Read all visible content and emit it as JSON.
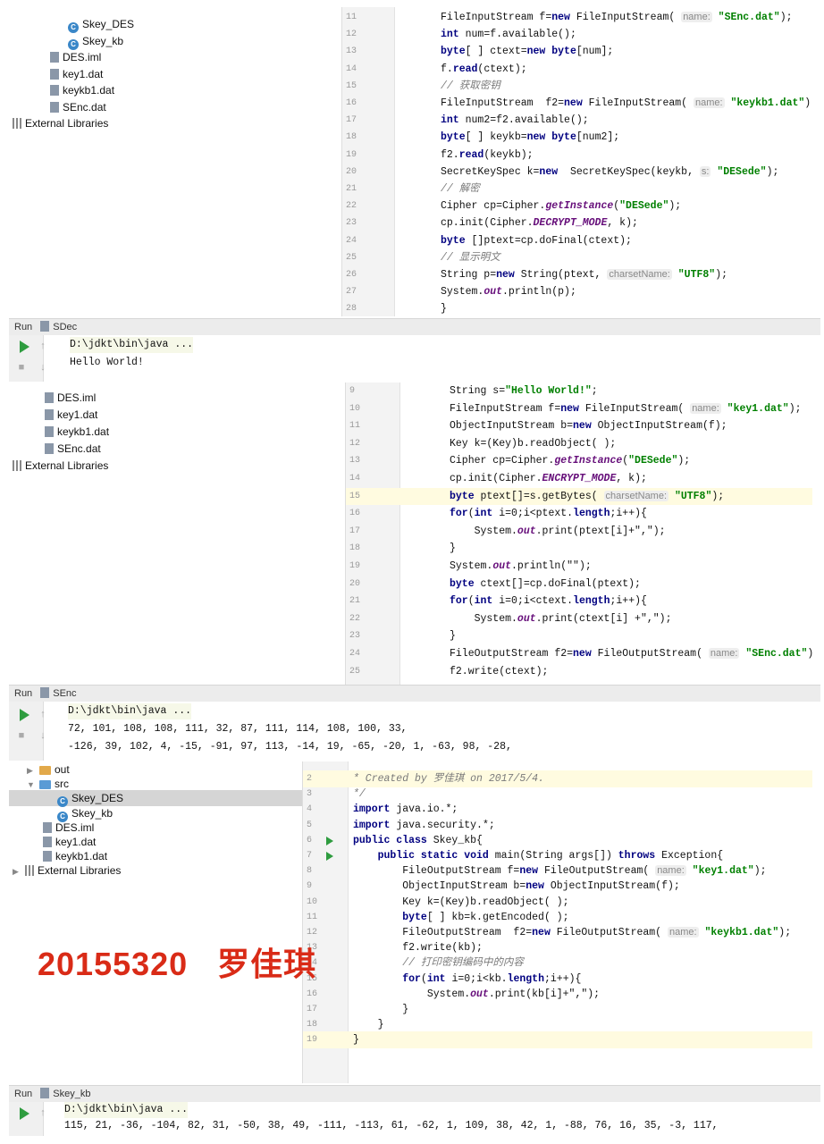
{
  "p1": {
    "tree": [
      {
        "label": "Skey_DES",
        "icon": "class-icon"
      },
      {
        "label": "Skey_kb",
        "icon": "class-icon"
      },
      {
        "label": "DES.iml",
        "icon": "file-icon"
      },
      {
        "label": "key1.dat",
        "icon": "file-icon"
      },
      {
        "label": "keykb1.dat",
        "icon": "file-icon"
      },
      {
        "label": "SEnc.dat",
        "icon": "file-icon"
      },
      {
        "label": "External Libraries",
        "icon": "library-icon"
      }
    ],
    "lines": [
      {
        "n": "11",
        "segs": [
          [
            "",
            "FileInputStream f="
          ],
          [
            "kw",
            "new"
          ],
          [
            "",
            " FileInputStream( "
          ],
          [
            "hint",
            "name:"
          ],
          [
            "",
            " "
          ],
          [
            "str",
            "\"SEnc.dat\""
          ],
          [
            "",
            ");"
          ]
        ]
      },
      {
        "n": "12",
        "segs": [
          [
            "kw",
            "int"
          ],
          [
            "",
            " num=f.available();"
          ]
        ]
      },
      {
        "n": "13",
        "segs": [
          [
            "kw",
            "byte"
          ],
          [
            "",
            "[ ] ctext="
          ],
          [
            "kw",
            "new"
          ],
          [
            "",
            " "
          ],
          [
            "kw",
            "byte"
          ],
          [
            "",
            "[num];"
          ]
        ]
      },
      {
        "n": "14",
        "segs": [
          [
            "",
            "f."
          ],
          [
            "kw",
            "read"
          ],
          [
            "",
            "(ctext);"
          ]
        ]
      },
      {
        "n": "15",
        "segs": [
          [
            "cm",
            "// 获取密钥"
          ]
        ]
      },
      {
        "n": "16",
        "segs": [
          [
            "",
            "FileInputStream  f2="
          ],
          [
            "kw",
            "new"
          ],
          [
            "",
            " FileInputStream( "
          ],
          [
            "hint",
            "name:"
          ],
          [
            "",
            " "
          ],
          [
            "str",
            "\"keykb1.dat\""
          ],
          [
            "",
            ");"
          ]
        ]
      },
      {
        "n": "17",
        "segs": [
          [
            "kw",
            "int"
          ],
          [
            "",
            " num2=f2.available();"
          ]
        ]
      },
      {
        "n": "18",
        "segs": [
          [
            "kw",
            "byte"
          ],
          [
            "",
            "[ ] keykb="
          ],
          [
            "kw",
            "new"
          ],
          [
            "",
            " "
          ],
          [
            "kw",
            "byte"
          ],
          [
            "",
            "[num2];"
          ]
        ]
      },
      {
        "n": "19",
        "segs": [
          [
            "",
            "f2."
          ],
          [
            "kw",
            "read"
          ],
          [
            "",
            "(keykb);"
          ]
        ]
      },
      {
        "n": "20",
        "segs": [
          [
            "",
            "SecretKeySpec k="
          ],
          [
            "kw",
            "new"
          ],
          [
            "",
            "  SecretKeySpec(keykb, "
          ],
          [
            "hint",
            "s:"
          ],
          [
            "",
            " "
          ],
          [
            "str",
            "\"DESede\""
          ],
          [
            "",
            ");"
          ]
        ]
      },
      {
        "n": "21",
        "segs": [
          [
            "cm",
            "// 解密"
          ]
        ]
      },
      {
        "n": "22",
        "segs": [
          [
            "",
            "Cipher cp=Cipher."
          ],
          [
            "it",
            "getInstance"
          ],
          [
            "",
            "("
          ],
          [
            "str",
            "\"DESede\""
          ],
          [
            "",
            ");"
          ]
        ]
      },
      {
        "n": "23",
        "segs": [
          [
            "",
            "cp.init(Cipher."
          ],
          [
            "it",
            "DECRYPT_MODE"
          ],
          [
            "",
            ", k);"
          ]
        ]
      },
      {
        "n": "24",
        "segs": [
          [
            "kw",
            "byte"
          ],
          [
            "",
            " []ptext=cp.doFinal(ctext);"
          ]
        ]
      },
      {
        "n": "25",
        "segs": [
          [
            "cm",
            "// 显示明文"
          ]
        ]
      },
      {
        "n": "26",
        "segs": [
          [
            "",
            "String p="
          ],
          [
            "kw",
            "new"
          ],
          [
            "",
            " String(ptext, "
          ],
          [
            "hint",
            "charsetName:"
          ],
          [
            "",
            " "
          ],
          [
            "str",
            "\"UTF8\""
          ],
          [
            "",
            ");"
          ]
        ]
      },
      {
        "n": "27",
        "segs": [
          [
            "",
            "System."
          ],
          [
            "it",
            "out"
          ],
          [
            "",
            ".println(p);"
          ]
        ]
      },
      {
        "n": "28",
        "segs": [
          [
            "",
            "}"
          ]
        ]
      }
    ],
    "run_label": "Run",
    "run_tab": "SDec",
    "console": [
      "D:\\jdkt\\bin\\java ...",
      "Hello World!"
    ]
  },
  "p2": {
    "tree": [
      {
        "label": "DES.iml",
        "icon": "file-icon"
      },
      {
        "label": "key1.dat",
        "icon": "file-icon"
      },
      {
        "label": "keykb1.dat",
        "icon": "file-icon"
      },
      {
        "label": "SEnc.dat",
        "icon": "file-icon"
      },
      {
        "label": "External Libraries",
        "icon": "library-icon"
      }
    ],
    "lines": [
      {
        "n": "9",
        "segs": [
          [
            "",
            "String s="
          ],
          [
            "str",
            "\"Hello World!\""
          ],
          [
            "",
            ";"
          ]
        ]
      },
      {
        "n": "10",
        "segs": [
          [
            "",
            "FileInputStream f="
          ],
          [
            "kw",
            "new"
          ],
          [
            "",
            " FileInputStream( "
          ],
          [
            "hint",
            "name:"
          ],
          [
            "",
            " "
          ],
          [
            "str",
            "\"key1.dat\""
          ],
          [
            "",
            ");"
          ]
        ]
      },
      {
        "n": "11",
        "segs": [
          [
            "",
            "ObjectInputStream b="
          ],
          [
            "kw",
            "new"
          ],
          [
            "",
            " ObjectInputStream(f);"
          ]
        ]
      },
      {
        "n": "12",
        "segs": [
          [
            "",
            "Key k=(Key)b.readObject( );"
          ]
        ]
      },
      {
        "n": "13",
        "segs": [
          [
            "",
            "Cipher cp=Cipher."
          ],
          [
            "it",
            "getInstance"
          ],
          [
            "",
            "("
          ],
          [
            "str",
            "\"DESede\""
          ],
          [
            "",
            ");"
          ]
        ]
      },
      {
        "n": "14",
        "segs": [
          [
            "",
            "cp.init(Cipher."
          ],
          [
            "it",
            "ENCRYPT_MODE"
          ],
          [
            "",
            ", k);"
          ]
        ]
      },
      {
        "n": "15",
        "segs": [
          [
            "kw",
            "byte"
          ],
          [
            "",
            " ptext[]=s.getBytes( "
          ],
          [
            "hint",
            "charsetName:"
          ],
          [
            "",
            " "
          ],
          [
            "str",
            "\"UTF8\""
          ],
          [
            "",
            ");"
          ]
        ],
        "hl": true
      },
      {
        "n": "16",
        "segs": [
          [
            "kw",
            "for"
          ],
          [
            "",
            "("
          ],
          [
            "kw",
            "int"
          ],
          [
            "",
            " i=0;i<ptext."
          ],
          [
            "kw",
            "length"
          ],
          [
            "",
            ";i++){"
          ]
        ]
      },
      {
        "n": "17",
        "segs": [
          [
            "",
            "    System."
          ],
          [
            "it",
            "out"
          ],
          [
            "",
            ".print(ptext[i]+\",\");"
          ]
        ]
      },
      {
        "n": "18",
        "segs": [
          [
            "",
            "}"
          ]
        ]
      },
      {
        "n": "19",
        "segs": [
          [
            "",
            "System."
          ],
          [
            "it",
            "out"
          ],
          [
            "",
            ".println(\"\");"
          ]
        ]
      },
      {
        "n": "20",
        "segs": [
          [
            "kw",
            "byte"
          ],
          [
            "",
            " ctext[]=cp.doFinal(ptext);"
          ]
        ]
      },
      {
        "n": "21",
        "segs": [
          [
            "kw",
            "for"
          ],
          [
            "",
            "("
          ],
          [
            "kw",
            "int"
          ],
          [
            "",
            " i=0;i<ctext."
          ],
          [
            "kw",
            "length"
          ],
          [
            "",
            ";i++){"
          ]
        ]
      },
      {
        "n": "22",
        "segs": [
          [
            "",
            "    System."
          ],
          [
            "it",
            "out"
          ],
          [
            "",
            ".print(ctext[i] +\",\");"
          ]
        ]
      },
      {
        "n": "23",
        "segs": [
          [
            "",
            "}"
          ]
        ]
      },
      {
        "n": "24",
        "segs": [
          [
            "",
            "FileOutputStream f2="
          ],
          [
            "kw",
            "new"
          ],
          [
            "",
            " FileOutputStream( "
          ],
          [
            "hint",
            "name:"
          ],
          [
            "",
            " "
          ],
          [
            "str",
            "\"SEnc.dat\""
          ],
          [
            "",
            ");"
          ]
        ]
      },
      {
        "n": "25",
        "segs": [
          [
            "",
            "f2.write(ctext);"
          ]
        ]
      }
    ],
    "run_label": "Run",
    "run_tab": "SEnc",
    "console": [
      "D:\\jdkt\\bin\\java ...",
      "72, 101, 108, 108, 111, 32, 87, 111, 114, 108, 100, 33,",
      "-126, 39, 102, 4, -15, -91, 97, 113, -14, 19, -65, -20, 1, -63, 98, -28,"
    ]
  },
  "p3": {
    "tree": [
      {
        "label": "out",
        "icon": "folder-icon",
        "arrow": "▶",
        "indent": 20
      },
      {
        "label": "src",
        "icon": "source-folder-icon",
        "arrow": "▼",
        "indent": 20
      },
      {
        "label": "Skey_DES",
        "icon": "class-icon",
        "indent": 54,
        "selected": true
      },
      {
        "label": "Skey_kb",
        "icon": "class-icon",
        "indent": 54
      },
      {
        "label": "DES.iml",
        "icon": "file-icon",
        "indent": 38
      },
      {
        "label": "key1.dat",
        "icon": "file-icon",
        "indent": 38
      },
      {
        "label": "keykb1.dat",
        "icon": "file-icon",
        "indent": 38
      },
      {
        "label": "External Libraries",
        "icon": "library-icon",
        "arrow": "▶",
        "indent": 4
      }
    ],
    "lines": [
      {
        "n": "2",
        "segs": [
          [
            "cm",
            "* Created by 罗佳琪 on 2017/5/4."
          ]
        ],
        "hl": true
      },
      {
        "n": "3",
        "segs": [
          [
            "cm",
            "*/"
          ]
        ]
      },
      {
        "n": "4",
        "segs": [
          [
            "kw",
            "import"
          ],
          [
            "",
            " java.io.*;"
          ]
        ]
      },
      {
        "n": "5",
        "segs": [
          [
            "kw",
            "import"
          ],
          [
            "",
            " java.security.*;"
          ]
        ]
      },
      {
        "n": "6",
        "segs": [
          [
            "kw",
            "public class"
          ],
          [
            "",
            " Skey_kb{"
          ]
        ],
        "run": true
      },
      {
        "n": "7",
        "segs": [
          [
            "",
            "    "
          ],
          [
            "kw",
            "public static void"
          ],
          [
            "",
            " main(String args[]) "
          ],
          [
            "kw",
            "throws"
          ],
          [
            "",
            " Exception{"
          ]
        ],
        "run": true
      },
      {
        "n": "8",
        "segs": [
          [
            "",
            "        FileOutputStream f="
          ],
          [
            "kw",
            "new"
          ],
          [
            "",
            " FileOutputStream( "
          ],
          [
            "hint",
            "name:"
          ],
          [
            "",
            " "
          ],
          [
            "str",
            "\"key1.dat\""
          ],
          [
            "",
            ");"
          ]
        ]
      },
      {
        "n": "9",
        "segs": [
          [
            "",
            "        ObjectInputStream b="
          ],
          [
            "kw",
            "new"
          ],
          [
            "",
            " ObjectInputStream(f);"
          ]
        ]
      },
      {
        "n": "10",
        "segs": [
          [
            "",
            "        Key k=(Key)b.readObject( );"
          ]
        ]
      },
      {
        "n": "11",
        "segs": [
          [
            "",
            "        "
          ],
          [
            "kw",
            "byte"
          ],
          [
            "",
            "[ ] kb=k.getEncoded( );"
          ]
        ]
      },
      {
        "n": "12",
        "segs": [
          [
            "",
            "        FileOutputStream  f2="
          ],
          [
            "kw",
            "new"
          ],
          [
            "",
            " FileOutputStream( "
          ],
          [
            "hint",
            "name:"
          ],
          [
            "",
            " "
          ],
          [
            "str",
            "\"keykb1.dat\""
          ],
          [
            "",
            ");"
          ]
        ]
      },
      {
        "n": "13",
        "segs": [
          [
            "",
            "        f2.write(kb);"
          ]
        ]
      },
      {
        "n": "14",
        "segs": [
          [
            "",
            "        "
          ],
          [
            "cm",
            "// 打印密钥编码中的内容"
          ]
        ]
      },
      {
        "n": "15",
        "segs": [
          [
            "",
            "        "
          ],
          [
            "kw",
            "for"
          ],
          [
            "",
            "("
          ],
          [
            "kw",
            "int"
          ],
          [
            "",
            " i=0;i<kb."
          ],
          [
            "kw",
            "length"
          ],
          [
            "",
            ";i++){"
          ]
        ]
      },
      {
        "n": "16",
        "segs": [
          [
            "",
            "            System."
          ],
          [
            "it",
            "out"
          ],
          [
            "",
            ".print(kb[i]+\",\");"
          ]
        ]
      },
      {
        "n": "17",
        "segs": [
          [
            "",
            "        }"
          ]
        ]
      },
      {
        "n": "18",
        "segs": [
          [
            "",
            "    }"
          ]
        ]
      },
      {
        "n": "19",
        "segs": [
          [
            "",
            "}"
          ]
        ],
        "hl": true
      }
    ],
    "run_label": "Run",
    "run_tab": "Skey_kb",
    "console": [
      "D:\\jdkt\\bin\\java ...",
      "115, 21, -36, -104, 82, 31, -50, 38, 49, -111, -113, 61, -62, 1, 109, 38, 42, 1, -88, 76, 16, 35, -3, 117,"
    ]
  },
  "watermark": "20155320   罗佳琪"
}
